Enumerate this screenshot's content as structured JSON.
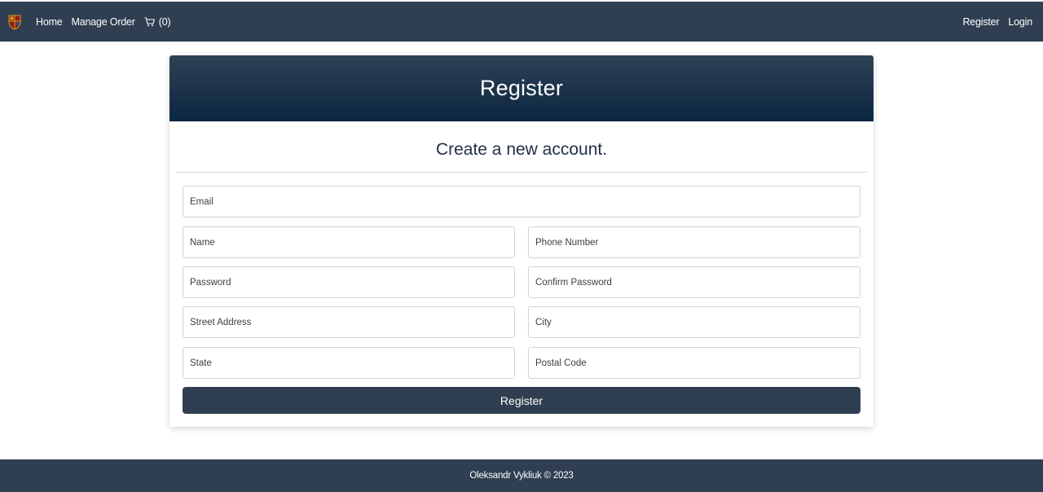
{
  "navbar": {
    "links": {
      "home": "Home",
      "manage_order": "Manage Order"
    },
    "cart_count": "(0)",
    "auth": {
      "register": "Register",
      "login": "Login"
    }
  },
  "card": {
    "title": "Register",
    "subtitle": "Create a new account.",
    "fields": {
      "email": "Email",
      "name": "Name",
      "phone": "Phone Number",
      "password": "Password",
      "confirm_password": "Confirm Password",
      "street": "Street Address",
      "city": "City",
      "state": "State",
      "postal": "Postal Code"
    },
    "submit_label": "Register"
  },
  "footer": {
    "text": "Oleksandr Vykliuk © 2023"
  },
  "colors": {
    "navbar_bg": "#2f3e50",
    "header_gradient_top": "#2f4256",
    "header_gradient_bottom": "#0b2640",
    "button_bg": "#2f3e50"
  }
}
